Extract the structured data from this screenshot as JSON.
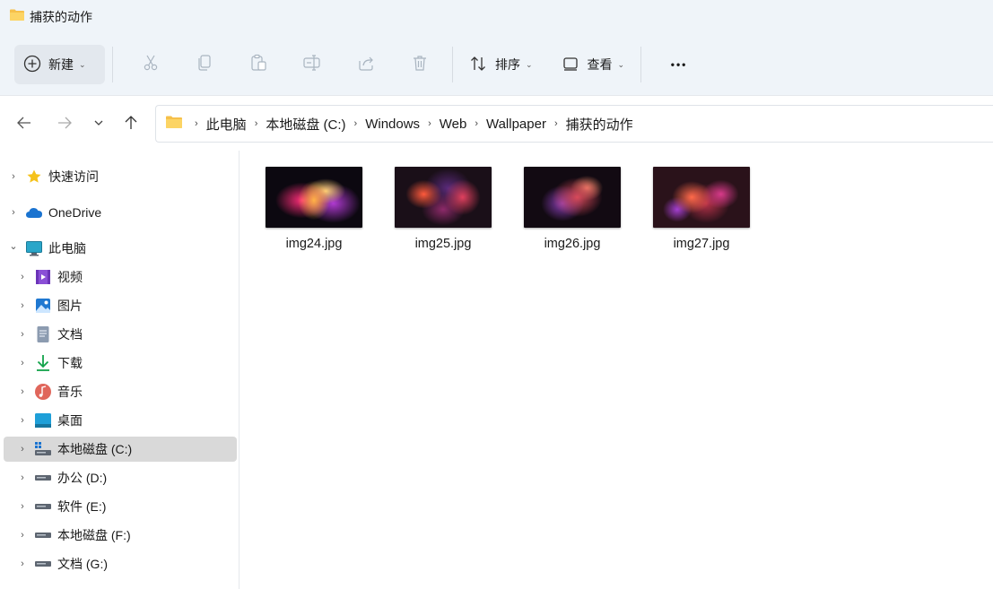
{
  "window": {
    "title": "捕获的动作"
  },
  "toolbar": {
    "new_label": "新建",
    "sort_label": "排序",
    "view_label": "查看",
    "more_label": "•••",
    "chevron": "⌄"
  },
  "address": {
    "crumbs": [
      "此电脑",
      "本地磁盘 (C:)",
      "Windows",
      "Web",
      "Wallpaper",
      "捕获的动作"
    ],
    "separator": "›"
  },
  "sidebar": {
    "items": [
      {
        "label": "快速访问",
        "icon": "star-icon"
      },
      {
        "label": "OneDrive",
        "icon": "cloud-icon"
      },
      {
        "label": "此电脑",
        "icon": "monitor-icon"
      },
      {
        "label": "视频",
        "icon": "video-icon"
      },
      {
        "label": "图片",
        "icon": "pictures-icon"
      },
      {
        "label": "文档",
        "icon": "document-icon"
      },
      {
        "label": "下载",
        "icon": "download-icon"
      },
      {
        "label": "音乐",
        "icon": "music-icon"
      },
      {
        "label": "桌面",
        "icon": "desktop-icon"
      },
      {
        "label": "本地磁盘 (C:)",
        "icon": "system-drive-icon"
      },
      {
        "label": "办公 (D:)",
        "icon": "drive-icon"
      },
      {
        "label": "软件 (E:)",
        "icon": "drive-icon"
      },
      {
        "label": "本地磁盘 (F:)",
        "icon": "drive-icon"
      },
      {
        "label": "文档 (G:)",
        "icon": "drive-icon"
      }
    ],
    "chevron_right": "›",
    "chevron_down": "⌄"
  },
  "files": [
    {
      "name": "img24.jpg"
    },
    {
      "name": "img25.jpg"
    },
    {
      "name": "img26.jpg"
    },
    {
      "name": "img27.jpg"
    }
  ],
  "colors": {
    "accent": "#0067c0",
    "folder": "#f6c04a",
    "selected": "#d9d9d9"
  }
}
